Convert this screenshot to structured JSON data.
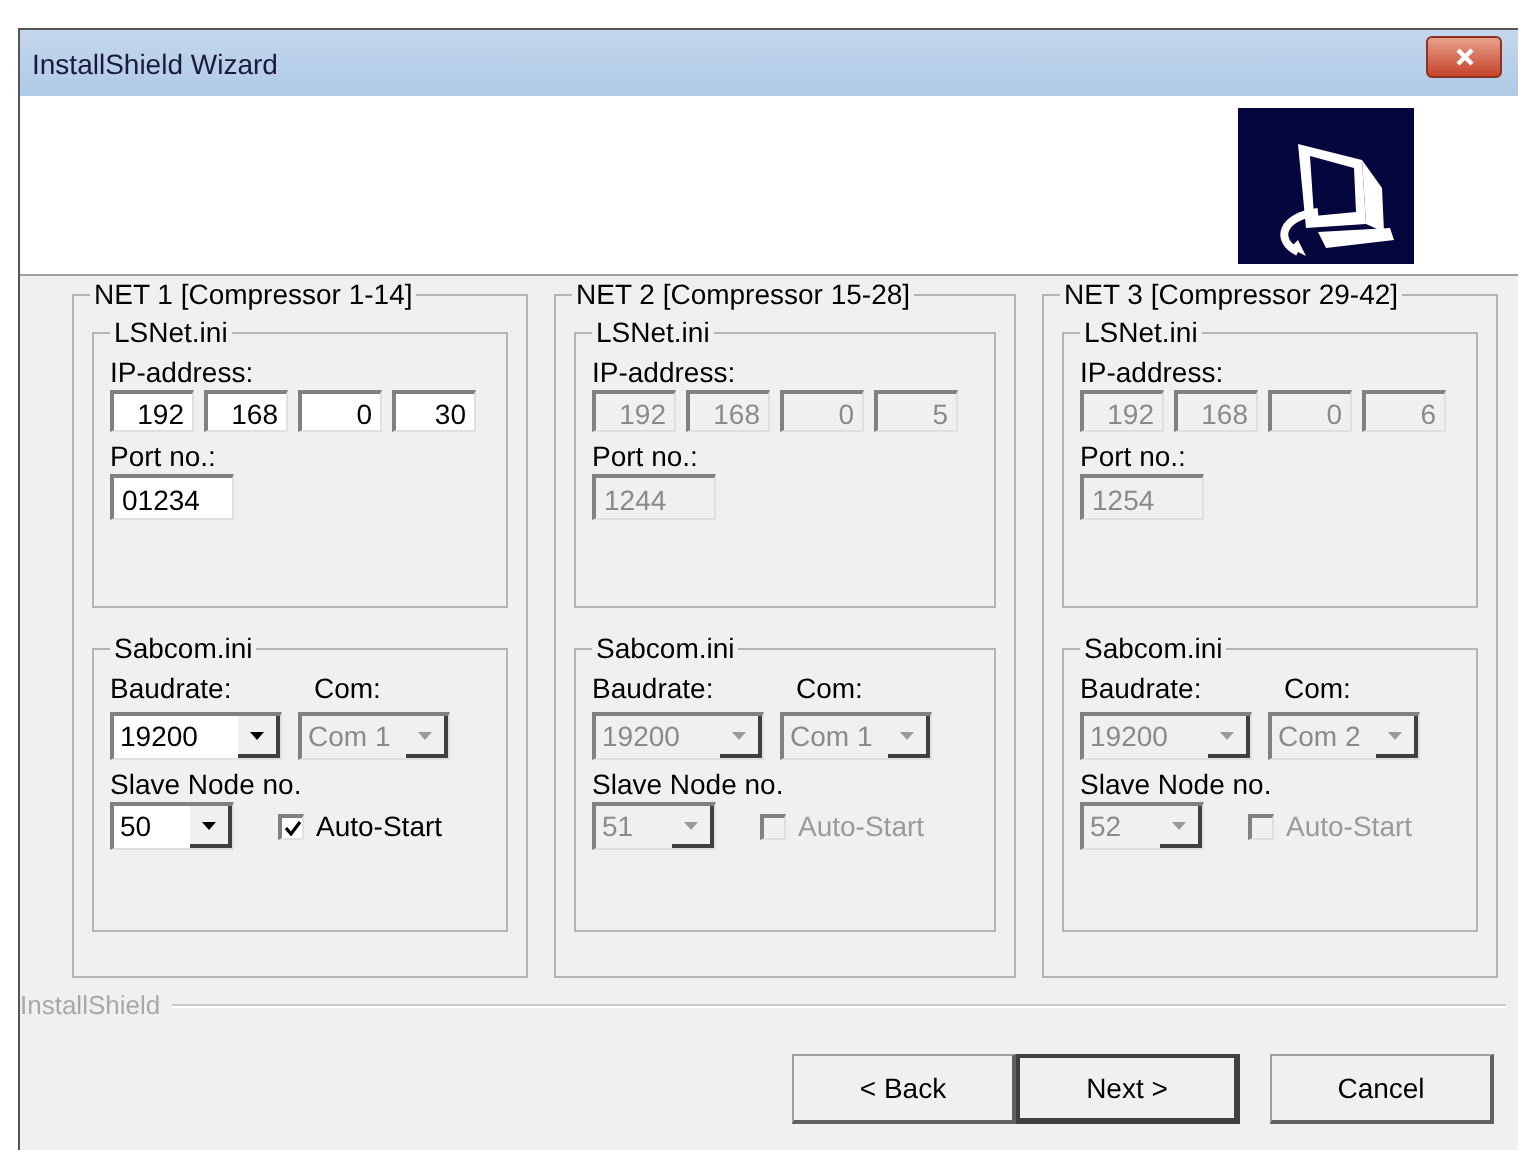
{
  "window": {
    "title": "InstallShield Wizard"
  },
  "nets": [
    {
      "title": "NET 1 [Compressor 1-14]",
      "lsnet": {
        "title": "LSNet.ini",
        "ip_label": "IP-address:",
        "ip": [
          {
            "value": "192",
            "disabled": false
          },
          {
            "value": "168",
            "disabled": false
          },
          {
            "value": "0",
            "disabled": false
          },
          {
            "value": "30",
            "disabled": false
          }
        ],
        "port_label": "Port no.:",
        "port": {
          "value": "01234",
          "disabled": false
        }
      },
      "sabcom": {
        "title": "Sabcom.ini",
        "baud_label": "Baudrate:",
        "com_label": "Com:",
        "baudrate": {
          "value": "19200",
          "disabled": false
        },
        "com": {
          "value": "Com 1",
          "disabled": true
        },
        "slave_label": "Slave Node no.",
        "slave_node": {
          "value": "50",
          "disabled": false
        },
        "auto_start": {
          "label": "Auto-Start",
          "checked": true,
          "disabled": false
        }
      }
    },
    {
      "title": "NET 2 [Compressor 15-28]",
      "lsnet": {
        "title": "LSNet.ini",
        "ip_label": "IP-address:",
        "ip": [
          {
            "value": "192",
            "disabled": true
          },
          {
            "value": "168",
            "disabled": true
          },
          {
            "value": "0",
            "disabled": true
          },
          {
            "value": "5",
            "disabled": true
          }
        ],
        "port_label": "Port no.:",
        "port": {
          "value": "1244",
          "disabled": true
        }
      },
      "sabcom": {
        "title": "Sabcom.ini",
        "baud_label": "Baudrate:",
        "com_label": "Com:",
        "baudrate": {
          "value": "19200",
          "disabled": true
        },
        "com": {
          "value": "Com 1",
          "disabled": true
        },
        "slave_label": "Slave Node no.",
        "slave_node": {
          "value": "51",
          "disabled": true
        },
        "auto_start": {
          "label": "Auto-Start",
          "checked": false,
          "disabled": true
        }
      }
    },
    {
      "title": "NET 3 [Compressor 29-42]",
      "lsnet": {
        "title": "LSNet.ini",
        "ip_label": "IP-address:",
        "ip": [
          {
            "value": "192",
            "disabled": true
          },
          {
            "value": "168",
            "disabled": true
          },
          {
            "value": "0",
            "disabled": true
          },
          {
            "value": "6",
            "disabled": true
          }
        ],
        "port_label": "Port no.:",
        "port": {
          "value": "1254",
          "disabled": true
        }
      },
      "sabcom": {
        "title": "Sabcom.ini",
        "baud_label": "Baudrate:",
        "com_label": "Com:",
        "baudrate": {
          "value": "19200",
          "disabled": true
        },
        "com": {
          "value": "Com 2",
          "disabled": true
        },
        "slave_label": "Slave Node no.",
        "slave_node": {
          "value": "52",
          "disabled": true
        },
        "auto_start": {
          "label": "Auto-Start",
          "checked": false,
          "disabled": true
        }
      }
    }
  ],
  "footer_label": "InstallShield",
  "buttons": [
    {
      "label": "< Back",
      "default": false
    },
    {
      "label": "Next >",
      "default": true
    },
    {
      "label": "Cancel",
      "default": false
    }
  ]
}
